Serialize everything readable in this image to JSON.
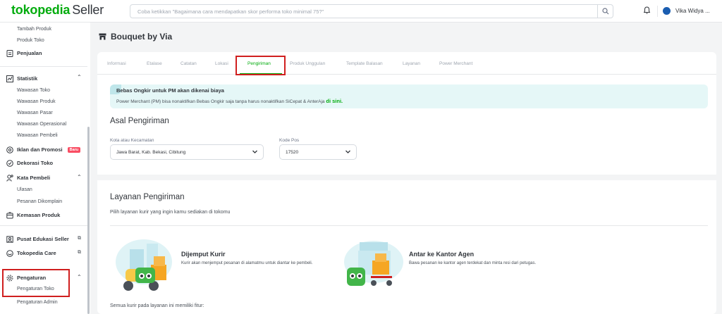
{
  "brand": {
    "logo_main": "tokopedia",
    "logo_sub": "Seller",
    "accent": "#03ac0e"
  },
  "search": {
    "placeholder": "Coba ketikkan \"Bagaimana cara mendapatkan skor performa toko minimal 75?\""
  },
  "header": {
    "username": "Vika Widya ..."
  },
  "sidebar": {
    "sub_top": [
      "Tambah Produk",
      "Produk Toko"
    ],
    "penjualan": "Penjualan",
    "statistik": {
      "label": "Statistik",
      "items": [
        "Wawasan Toko",
        "Wawasan Produk",
        "Wawasan Pasar",
        "Wawasan Operasional",
        "Wawasan Pembeli"
      ]
    },
    "iklan": {
      "label": "Iklan dan Promosi",
      "badge": "Baru"
    },
    "dekorasi": "Dekorasi Toko",
    "kata_pembeli": {
      "label": "Kata Pembeli",
      "items": [
        "Ulasan",
        "Pesanan Dikomplain"
      ]
    },
    "kemasan": "Kemasan Produk",
    "pusat_edukasi": "Pusat Edukasi Seller",
    "care": "Tokopedia Care",
    "pengaturan": {
      "label": "Pengaturan",
      "items": [
        "Pengaturan Toko",
        "Pengaturan Admin"
      ]
    }
  },
  "shop": {
    "name": "Bouquet by Via"
  },
  "tabs": [
    "Informasi",
    "Etalase",
    "Catatan",
    "Lokasi",
    "Pengiriman",
    "Produk Unggulan",
    "Template Balasan",
    "Layanan",
    "Power Merchant"
  ],
  "active_tab": "Pengiriman",
  "notice": {
    "title": "Bebas Ongkir untuk PM akan dikenai biaya",
    "text": "Power Merchant (PM) bisa nonaktifkan Bebas Ongkir saja tanpa harus nonaktifkan SiCepat & AnterAja",
    "link": "di sini."
  },
  "asal": {
    "title": "Asal Pengiriman",
    "kota_label": "Kota atau Kecamatan",
    "kota_value": "Jawa Barat, Kab. Bekasi, Cibitung",
    "kodepos_label": "Kode Pos",
    "kodepos_value": "17520"
  },
  "layanan": {
    "title": "Layanan Pengiriman",
    "subtitle": "Pilih layanan kurir yang ingin kamu sediakan di tokomu",
    "options": [
      {
        "title": "Dijemput Kurir",
        "desc": "Kurir akan menjemput pesanan di alamatmu untuk diantar ke pembeli."
      },
      {
        "title": "Antar ke Kantor Agen",
        "desc": "Bawa pesanan ke kantor agen terdekat dan minta resi dari petugas."
      }
    ],
    "footer": "Semua kurir pada layanan ini memiliki fitur:"
  },
  "icons": [
    "search-icon",
    "bell-icon",
    "store-icon",
    "chevron-down-icon",
    "chevron-up-icon",
    "external-link-icon",
    "settings-icon"
  ]
}
